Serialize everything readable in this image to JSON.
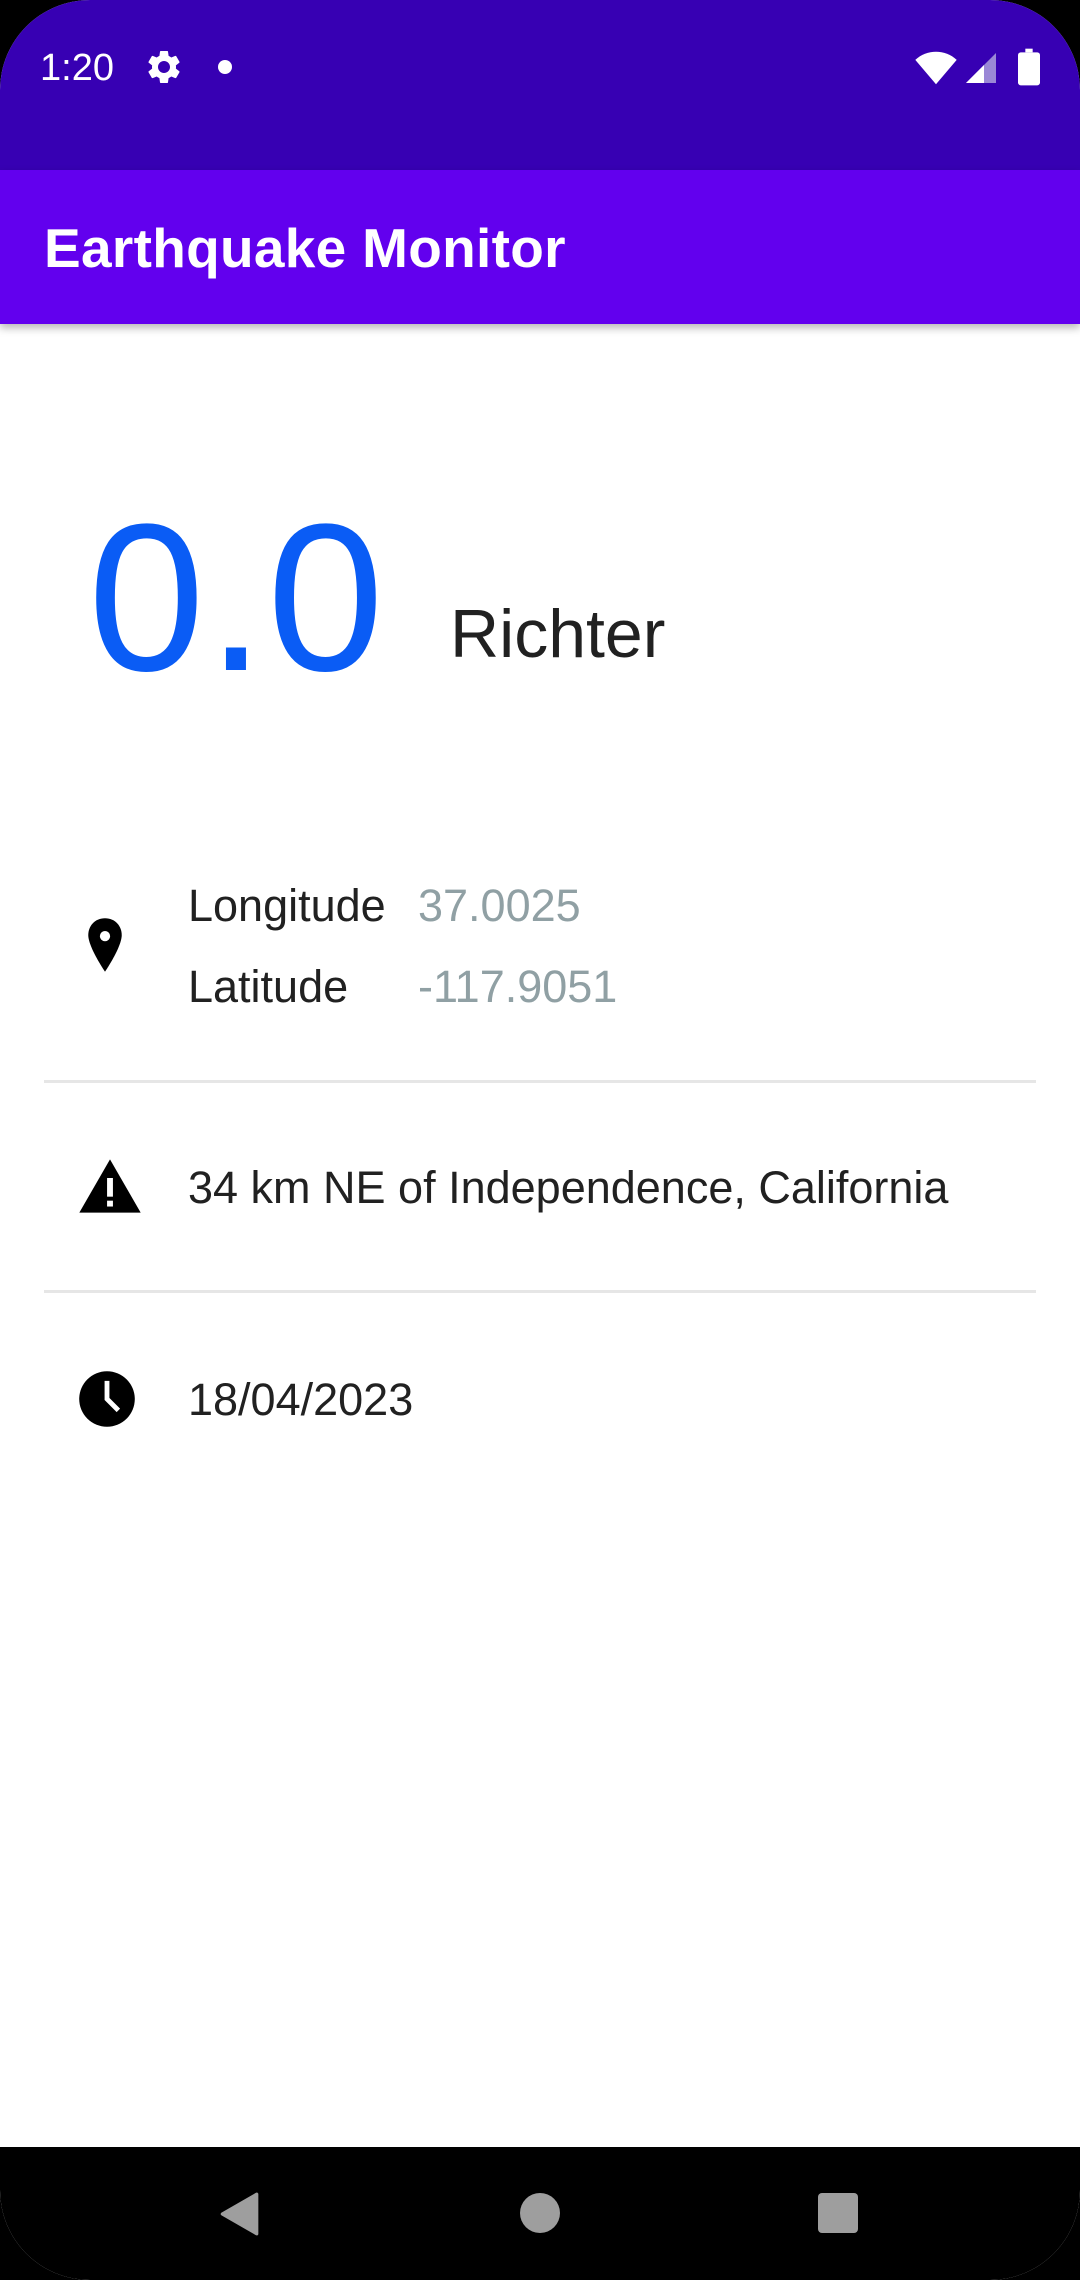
{
  "status_bar": {
    "time": "1:20",
    "icons": [
      "gear-icon",
      "notification-dot-icon",
      "wifi-icon",
      "signal-icon",
      "battery-icon"
    ]
  },
  "app_bar": {
    "title": "Earthquake Monitor",
    "color": "#6200ee"
  },
  "magnitude": {
    "value": "0.0",
    "unit": "Richter",
    "color": "#0a5cf5"
  },
  "coordinates": {
    "icon": "location-pin-icon",
    "longitude_label": "Longitude",
    "longitude_value": "37.0025",
    "latitude_label": "Latitude",
    "latitude_value": "-117.9051"
  },
  "location": {
    "icon": "warning-icon",
    "text": "34 km NE of Independence, California"
  },
  "date": {
    "icon": "clock-icon",
    "text": "18/04/2023"
  },
  "nav_bar": {
    "buttons": [
      "back-icon",
      "home-icon",
      "recents-icon"
    ]
  }
}
